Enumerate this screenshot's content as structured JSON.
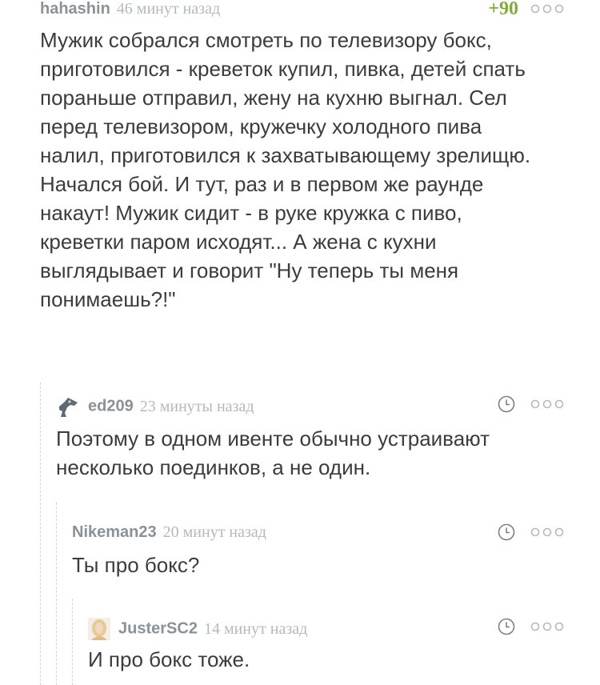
{
  "comments": [
    {
      "username": "hahashin",
      "time": "46 минут назад",
      "rating": "+90",
      "lines": [
        "Мужик собрался смотреть по телевизору бокс,",
        "приготовился - креветок купил, пивка, детей спать",
        "пораньше отправил, жену на кухню выгнал. Сел",
        "перед телевизором, кружечку холодного пива",
        "налил, приготовился к захватывающему зрелищю.",
        "Начался бой. И тут, раз и в первом же раунде",
        "накаут! Мужик сидит - в руке кружка с пиво,",
        "креветки паром исходят... А жена с кухни",
        "выглядывает и говорит \"Ну теперь ты меня",
        "понимаешь?!\""
      ]
    },
    {
      "username": "ed209",
      "time": "23 минуты назад",
      "avatar_icon": "robot-avatar-icon",
      "lines": [
        "Поэтому в одном ивенте обычно устраивают",
        "несколько поединков, а не один."
      ]
    },
    {
      "username": "Nikeman23",
      "time": "20 минут назад",
      "lines": [
        "Ты про бокс?"
      ]
    },
    {
      "username": "JusterSC2",
      "time": "14 минут назад",
      "avatar_icon": "photo-avatar-icon",
      "lines": [
        "И про бокс тоже."
      ]
    }
  ],
  "icons": {
    "clock": "clock-icon",
    "more": "more-dots-icon"
  },
  "colors": {
    "username": "#8a9299",
    "timestamp": "#b4b9bd",
    "rating_positive": "#7fad3c",
    "text": "#3c3c3c"
  }
}
